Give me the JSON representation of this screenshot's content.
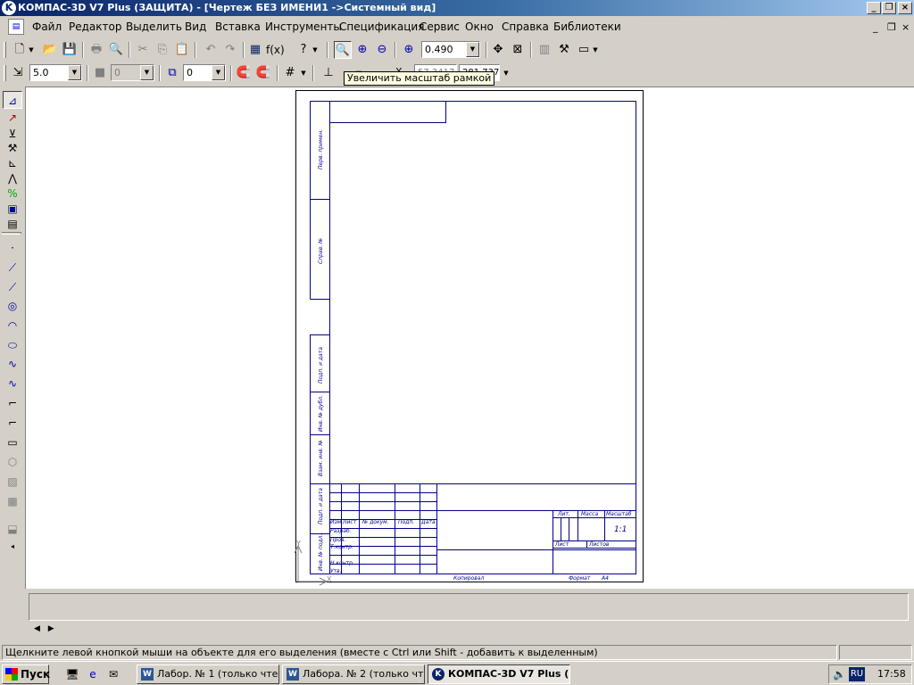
{
  "window": {
    "title": "КОМПАС-3D V7 Plus (ЗАЩИТА) - [Чертеж БЕЗ ИМЕНИ1 ->Системный вид]"
  },
  "menu": {
    "items": [
      "Файл",
      "Редактор",
      "Выделить",
      "Вид",
      "Вставка",
      "Инструменты",
      "Спецификация",
      "Сервис",
      "Окно",
      "Справка",
      "Библиотеки"
    ]
  },
  "toolbar": {
    "zoom_value": "0.490",
    "tooltip": "Увеличить масштаб рамкой"
  },
  "props": {
    "step": "5.0",
    "angle": "0",
    "layer": "0",
    "x_label": "X",
    "y_label": "Y",
    "x_value": "57.3417",
    "y_value": "281.737"
  },
  "drawing": {
    "side_labels": [
      "Перв. примен.",
      "Справ. №",
      "Подп. и дата",
      "Инв. № дубл.",
      "Взам. инв. №",
      "Подп. и дата",
      "Инв. № подл."
    ],
    "stamp": {
      "col_headers": [
        "Изм.",
        "Лист",
        "№ докум.",
        "Подп.",
        "Дата"
      ],
      "roles": [
        "Разраб.",
        "Пров.",
        "Т.контр.",
        "Н.контр.",
        "Утв."
      ],
      "lit": "Лит.",
      "mass": "Масса",
      "scale_label": "Масштаб",
      "scale_value": "1:1",
      "sheet": "Лист",
      "sheets": "Листов",
      "copied": "Копировал",
      "format": "Формат",
      "format_value": "А4"
    }
  },
  "status": {
    "text": "Щелкните левой кнопкой мыши на объекте для его выделения (вместе с Ctrl или Shift - добавить к выделенным)"
  },
  "taskbar": {
    "start": "Пуск",
    "tasks": [
      "Лабор. № 1 (только чте...",
      "Лабора. № 2 (только чт...",
      "КОМПАС-3D V7 Plus (З..."
    ],
    "lang": "RU",
    "clock": "17:58"
  }
}
